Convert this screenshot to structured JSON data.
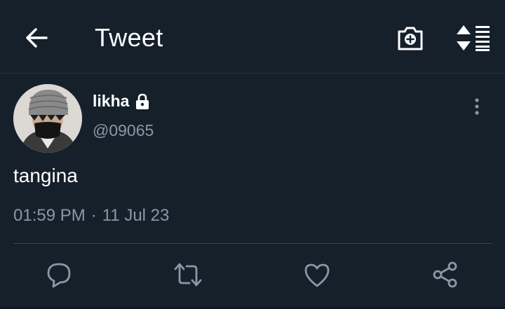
{
  "header": {
    "title": "Tweet",
    "back_icon": "arrow-left-icon",
    "camera_icon": "camera-plus-icon",
    "sort_icon": "sort-lines-icon"
  },
  "tweet": {
    "author": {
      "display_name": "likha",
      "handle": "@09065",
      "protected": true,
      "lock_icon": "lock-icon"
    },
    "text": "tangina",
    "time": "01:59 PM",
    "separator": "·",
    "date": "11 Jul 23"
  },
  "actions": [
    {
      "name": "reply",
      "icon": "reply-icon"
    },
    {
      "name": "retweet",
      "icon": "retweet-icon"
    },
    {
      "name": "like",
      "icon": "heart-icon"
    },
    {
      "name": "share",
      "icon": "share-icon"
    }
  ],
  "colors": {
    "background": "#15202b",
    "primary_text": "#ffffff",
    "secondary_text": "#8899a6",
    "divider": "#38444d"
  }
}
